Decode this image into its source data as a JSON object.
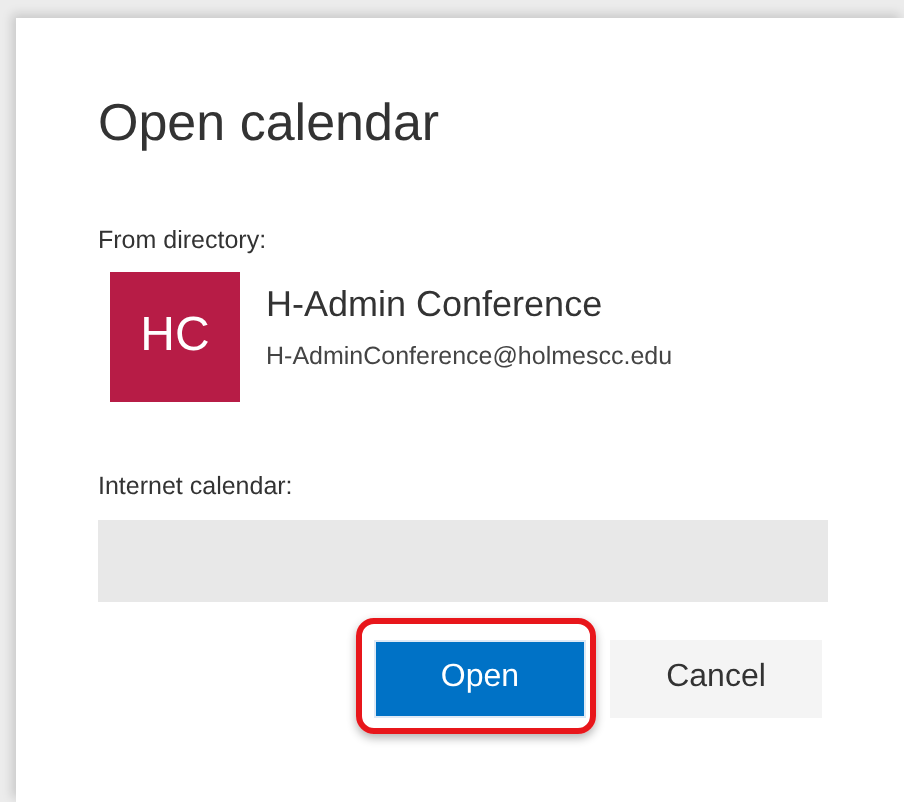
{
  "dialog": {
    "title": "Open calendar",
    "directory": {
      "label": "From directory:",
      "initials": "HC",
      "color": "#b71c46",
      "name": "H-Admin Conference",
      "email": "H-AdminConference@holmescc.edu"
    },
    "internet": {
      "label": "Internet calendar:"
    },
    "buttons": [
      {
        "label": "Open",
        "kind": "primary",
        "highlighted": true
      },
      {
        "label": "Cancel",
        "kind": "secondary",
        "highlighted": false
      }
    ]
  }
}
